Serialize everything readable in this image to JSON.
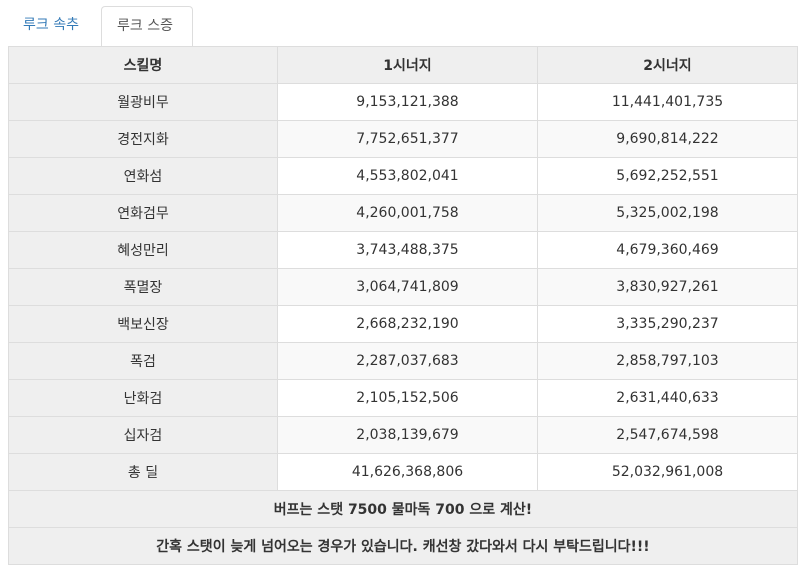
{
  "tabs": [
    {
      "label": "루크 속추"
    },
    {
      "label": "루크 스증"
    }
  ],
  "table": {
    "headers": [
      "스킬명",
      "1시너지",
      "2시너지"
    ],
    "rows": [
      {
        "name": "월광비무",
        "s1": "9,153,121,388",
        "s2": "11,441,401,735"
      },
      {
        "name": "경전지화",
        "s1": "7,752,651,377",
        "s2": "9,690,814,222"
      },
      {
        "name": "연화섬",
        "s1": "4,553,802,041",
        "s2": "5,692,252,551"
      },
      {
        "name": "연화검무",
        "s1": "4,260,001,758",
        "s2": "5,325,002,198"
      },
      {
        "name": "혜성만리",
        "s1": "3,743,488,375",
        "s2": "4,679,360,469"
      },
      {
        "name": "폭멸장",
        "s1": "3,064,741,809",
        "s2": "3,830,927,261"
      },
      {
        "name": "백보신장",
        "s1": "2,668,232,190",
        "s2": "3,335,290,237"
      },
      {
        "name": "폭검",
        "s1": "2,287,037,683",
        "s2": "2,858,797,103"
      },
      {
        "name": "난화검",
        "s1": "2,105,152,506",
        "s2": "2,631,440,633"
      },
      {
        "name": "십자검",
        "s1": "2,038,139,679",
        "s2": "2,547,674,598"
      },
      {
        "name": "총 딜",
        "s1": "41,626,368,806",
        "s2": "52,032,961,008"
      }
    ],
    "notes": [
      "버프는 스탯 7500 물마독 700 으로 계산!",
      "간혹 스탯이 늦게 넘어오는 경우가 있습니다. 캐선창 갔다와서 다시 부탁드립니다!!!"
    ]
  }
}
